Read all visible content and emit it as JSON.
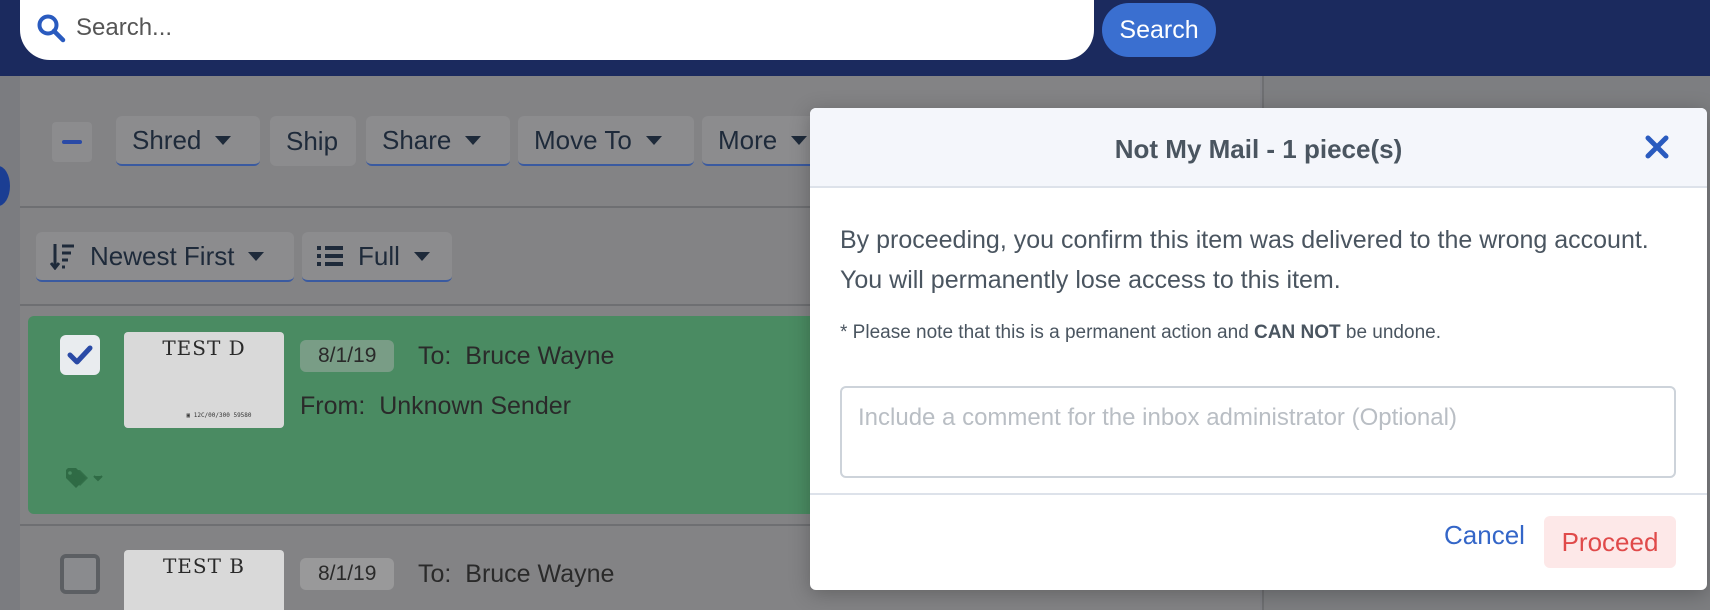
{
  "search": {
    "placeholder": "Search...",
    "button_label": "Search"
  },
  "toolbar": {
    "actions": [
      {
        "label": "Shred",
        "dropdown": true
      },
      {
        "label": "Ship",
        "dropdown": false
      },
      {
        "label": "Share",
        "dropdown": true
      },
      {
        "label": "Move To",
        "dropdown": true
      },
      {
        "label": "More",
        "dropdown": true
      }
    ]
  },
  "sort": {
    "order_label": "Newest First",
    "view_label": "Full"
  },
  "mail_items": [
    {
      "selected": true,
      "thumbnail_text": "TEST D",
      "barcode_text": "12C/00/300 59580",
      "date": "8/1/19",
      "to_label": "To:",
      "to": "Bruce Wayne",
      "from_label": "From:",
      "from": "Unknown Sender"
    },
    {
      "selected": false,
      "thumbnail_text": "TEST B",
      "date": "8/1/19",
      "to_label": "To:",
      "to": "Bruce Wayne"
    }
  ],
  "modal": {
    "title": "Not My Mail - 1 piece(s)",
    "body": "By proceeding, you confirm this item was delivered to the wrong account. You will permanently lose access to this item.",
    "note_prefix": "* Please note that this is a permanent action and",
    "note_emphasis": "CAN NOT",
    "note_suffix": "be undone.",
    "comment_placeholder": "Include a comment for the inbox administrator (Optional)",
    "cancel_label": "Cancel",
    "proceed_label": "Proceed"
  },
  "colors": {
    "topbar": "#1b2a5e",
    "accent_blue": "#3a6fd0",
    "selected_row": "#4a8b62",
    "proceed_text": "#e04a4a",
    "proceed_bg": "#fde8e8"
  }
}
